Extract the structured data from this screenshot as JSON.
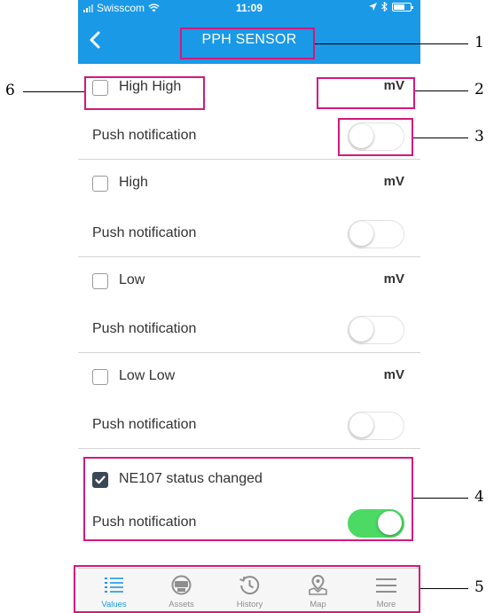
{
  "status_bar": {
    "carrier": "Swisscom",
    "time": "11:09"
  },
  "nav": {
    "title": "PPH SENSOR"
  },
  "thresholds": [
    {
      "label": "High High",
      "unit": "mV",
      "checked": false,
      "push_label": "Push notification",
      "push_on": false
    },
    {
      "label": "High",
      "unit": "mV",
      "checked": false,
      "push_label": "Push notification",
      "push_on": false
    },
    {
      "label": "Low",
      "unit": "mV",
      "checked": false,
      "push_label": "Push notification",
      "push_on": false
    },
    {
      "label": "Low Low",
      "unit": "mV",
      "checked": false,
      "push_label": "Push notification",
      "push_on": false
    }
  ],
  "status_change": {
    "label": "NE107 status changed",
    "checked": true,
    "push_label": "Push notification",
    "push_on": true
  },
  "tab_bar": {
    "tabs": [
      {
        "label": "Values",
        "icon": "list-icon",
        "active": true
      },
      {
        "label": "Assets",
        "icon": "sensor-icon",
        "active": false
      },
      {
        "label": "History",
        "icon": "history-icon",
        "active": false
      },
      {
        "label": "Map",
        "icon": "map-pin-icon",
        "active": false
      },
      {
        "label": "More",
        "icon": "menu-icon",
        "active": false
      }
    ]
  },
  "callouts": [
    "1",
    "2",
    "3",
    "4",
    "5",
    "6"
  ],
  "colors": {
    "accent": "#1a99e6",
    "highlight": "#d4197a",
    "toggle_on": "#4cd964",
    "checkbox_on": "#3a4756"
  }
}
